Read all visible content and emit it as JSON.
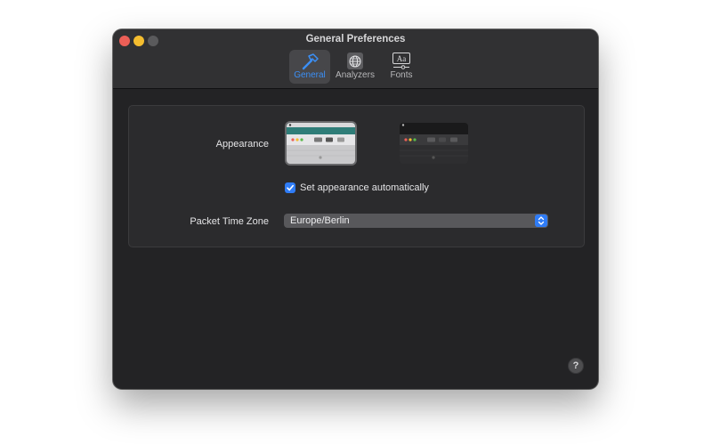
{
  "window": {
    "title": "General Preferences"
  },
  "toolbar": {
    "items": [
      {
        "label": "General",
        "icon": "hammer-icon",
        "active": true
      },
      {
        "label": "Analyzers",
        "icon": "globe-icon",
        "active": false
      },
      {
        "label": "Fonts",
        "icon": "font-icon",
        "active": false
      }
    ]
  },
  "appearance": {
    "label": "Appearance",
    "options": [
      {
        "name": "light",
        "selected": true
      },
      {
        "name": "dark",
        "selected": false
      }
    ],
    "auto_label": "Set appearance automatically",
    "auto_checked": true
  },
  "timezone": {
    "label": "Packet Time Zone",
    "value": "Europe/Berlin"
  },
  "help": {
    "label": "?"
  },
  "colors": {
    "accent": "#2f7cf6",
    "window_bg": "#232325",
    "close": "#ec5f57",
    "minimize": "#f4bd2f"
  }
}
